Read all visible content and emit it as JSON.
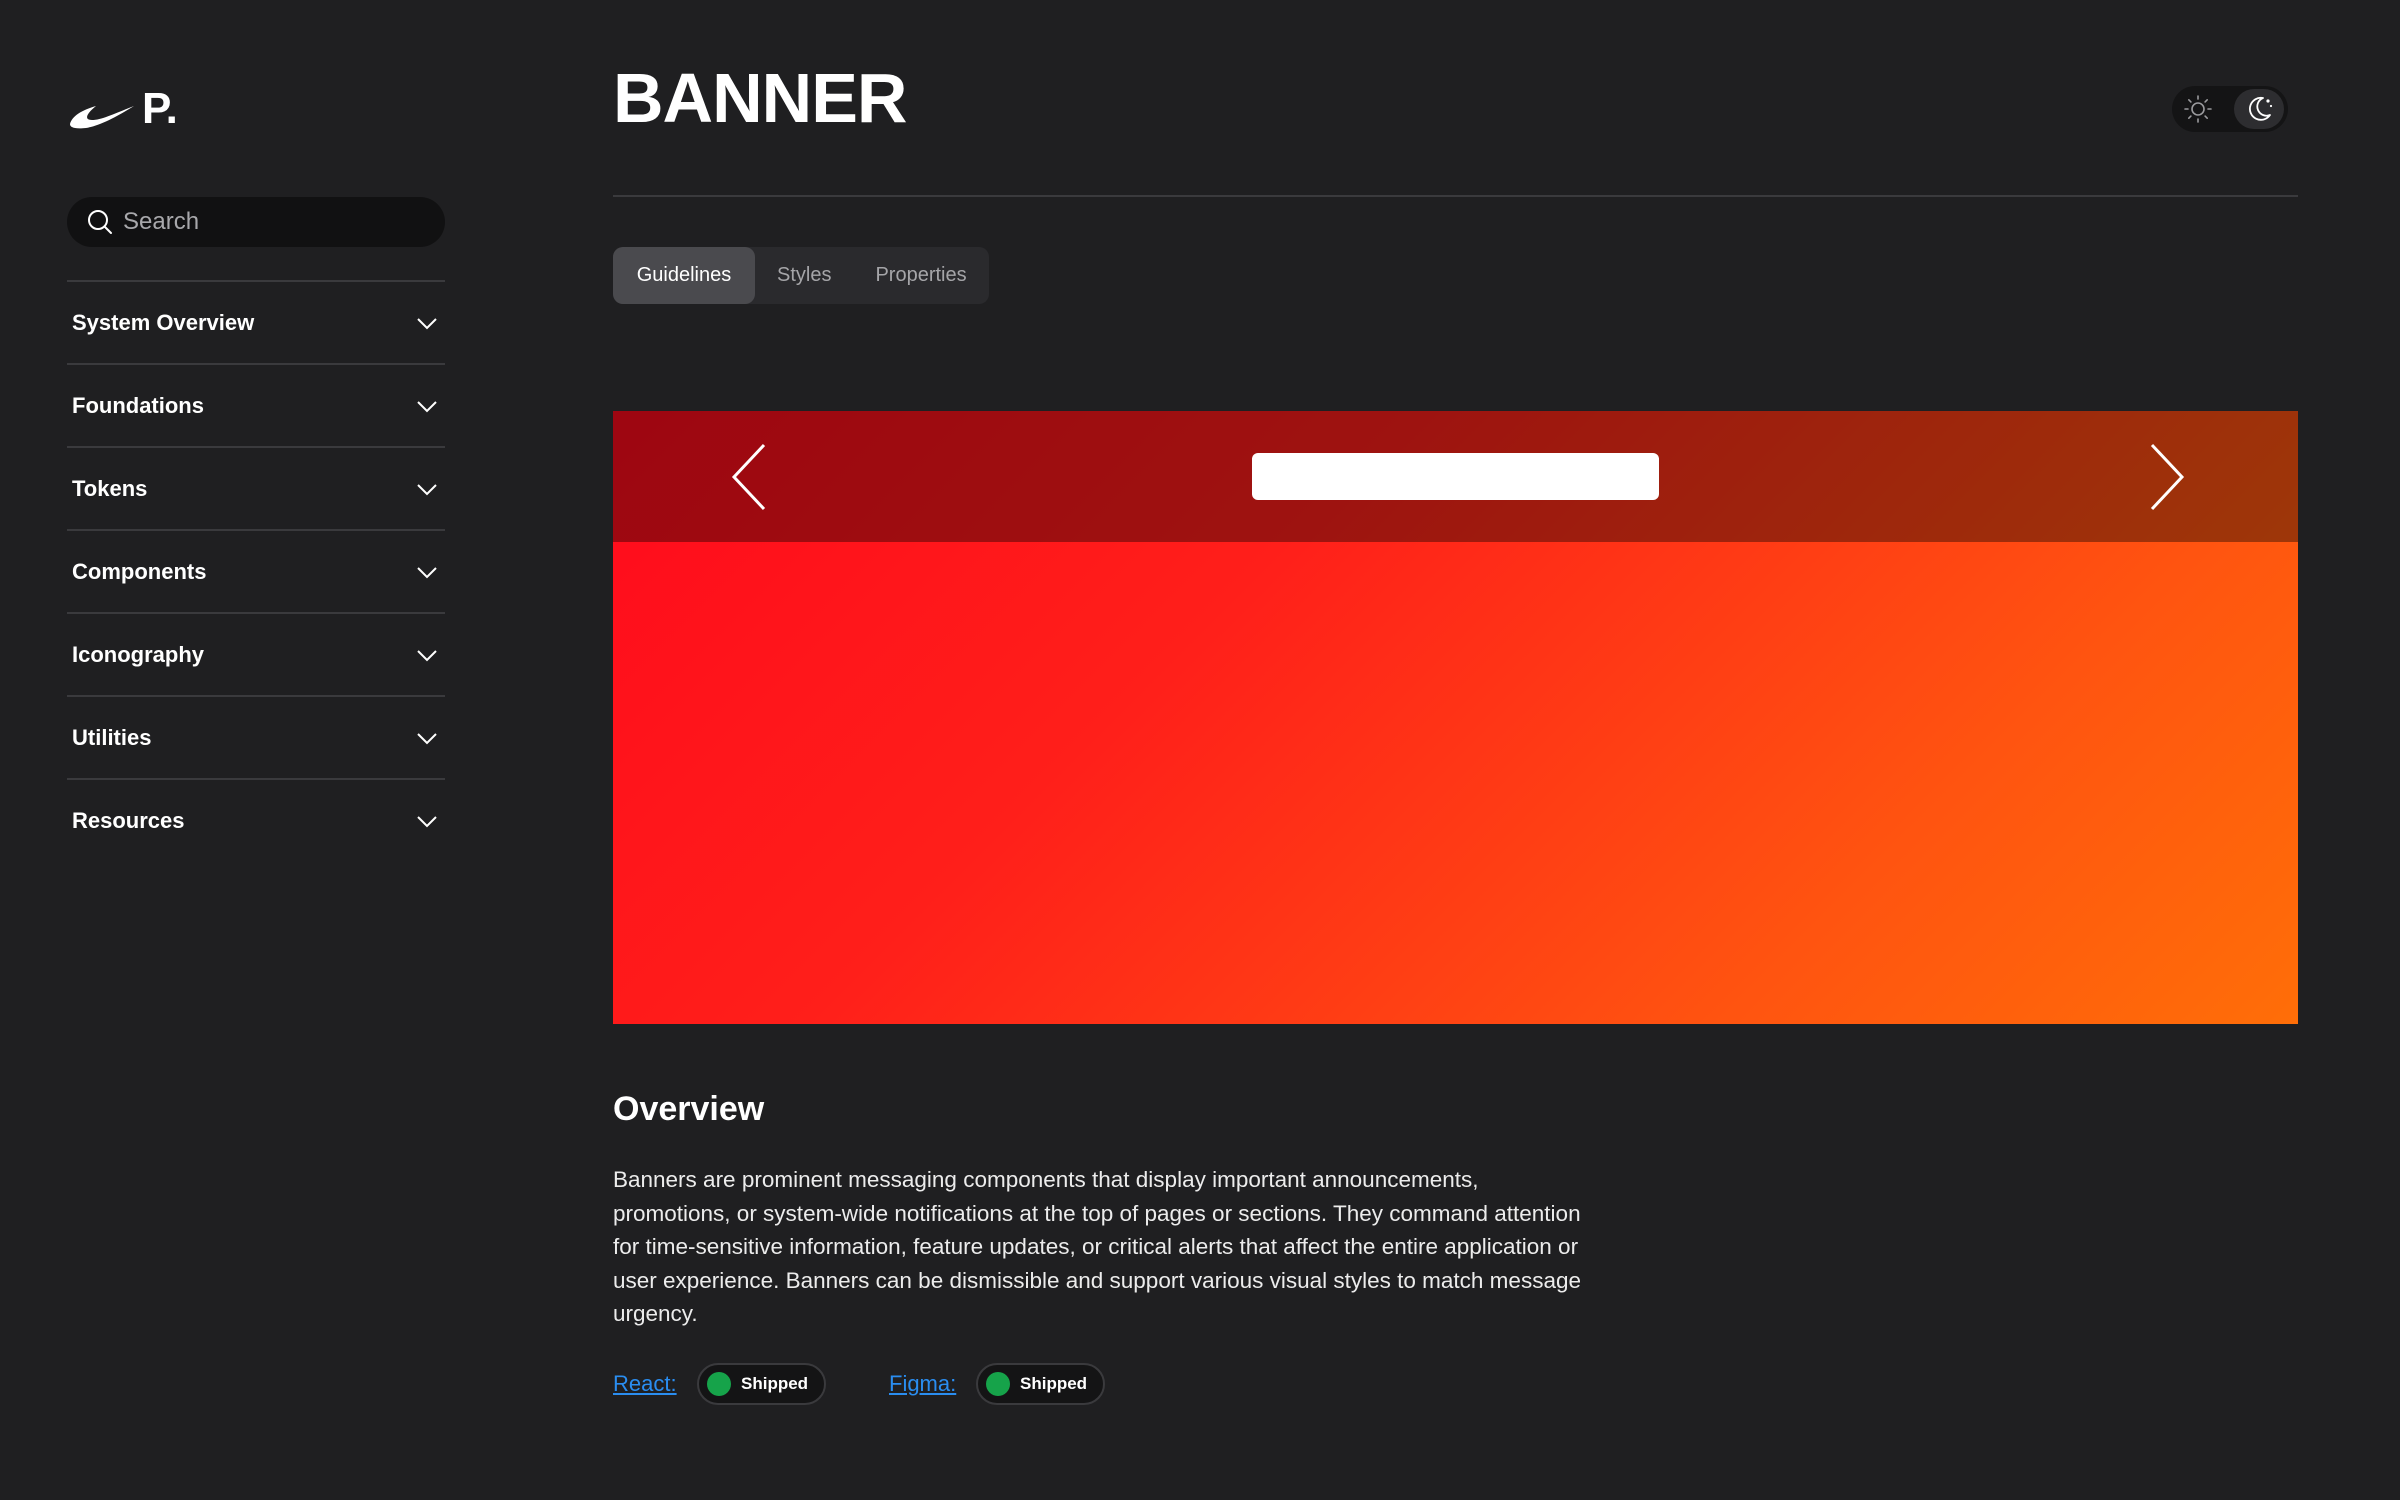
{
  "brand": {
    "logo_text": "P."
  },
  "search": {
    "placeholder": "Search"
  },
  "sidebar": {
    "items": [
      {
        "label": "System Overview"
      },
      {
        "label": "Foundations"
      },
      {
        "label": "Tokens"
      },
      {
        "label": "Components"
      },
      {
        "label": "Iconography"
      },
      {
        "label": "Utilities"
      },
      {
        "label": "Resources"
      }
    ]
  },
  "header": {
    "title": "BANNER"
  },
  "theme_toggle": {
    "options": [
      "sun-icon",
      "moon-icon"
    ],
    "selected": "dark"
  },
  "tabs": [
    {
      "label": "Guidelines",
      "active": true
    },
    {
      "label": "Styles",
      "active": false
    },
    {
      "label": "Properties",
      "active": false
    }
  ],
  "preview": {
    "colors": {
      "gradient_start": "#ff0a1c",
      "gradient_end": "#ff6e08"
    }
  },
  "overview": {
    "title": "Overview",
    "body": "Banners are prominent messaging components that display important announcements, promotions, or system-wide notifications at the top of pages or sections. They command attention for time-sensitive information, feature updates, or critical alerts that affect the entire application or user experience. Banners can be dismissible and support various visual styles to match message urgency."
  },
  "status": {
    "react": {
      "label": "React:",
      "badge": "Shipped"
    },
    "figma": {
      "label": "Figma:",
      "badge": "Shipped"
    },
    "colors": {
      "shipped": "#16a34a",
      "link": "#2a8df0"
    }
  }
}
